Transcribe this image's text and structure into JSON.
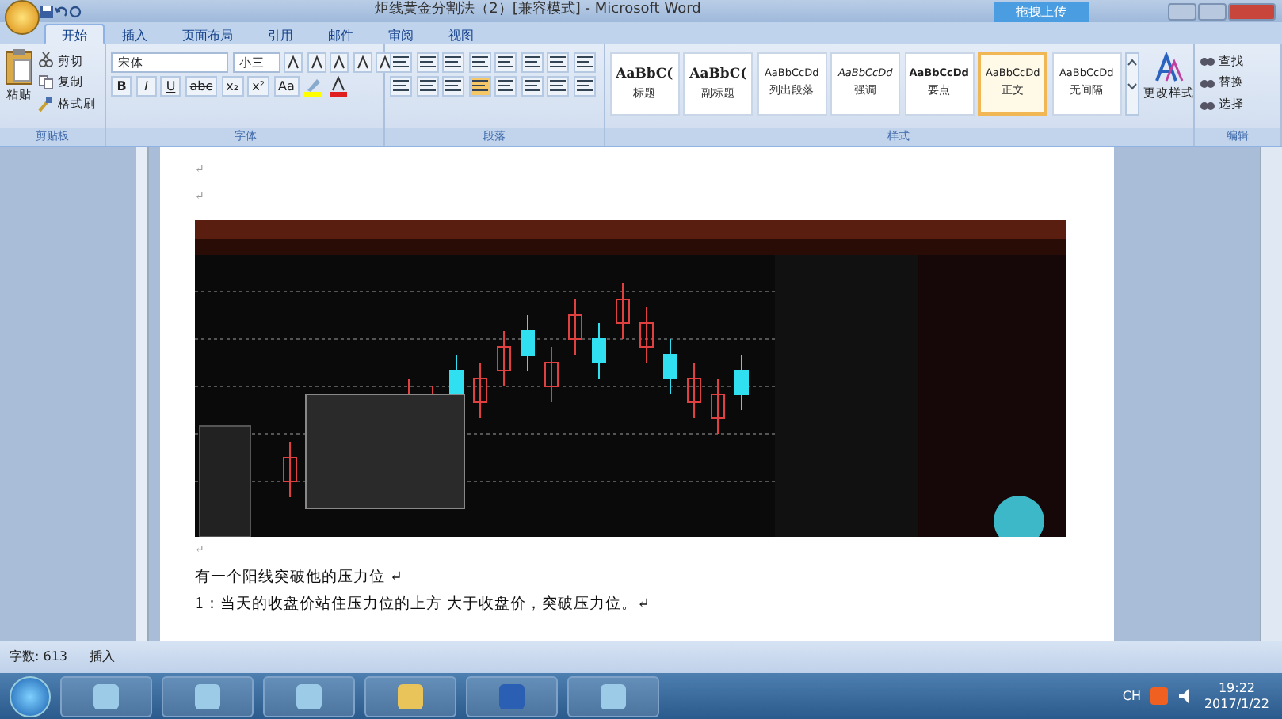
{
  "window": {
    "title": "炬线黄金分割法（2）[兼容模式] - Microsoft Word",
    "upload_button": "拖拽上传"
  },
  "tabs": [
    {
      "label": "开始",
      "selected": true
    },
    {
      "label": "插入",
      "selected": false
    },
    {
      "label": "页面布局",
      "selected": false
    },
    {
      "label": "引用",
      "selected": false
    },
    {
      "label": "邮件",
      "selected": false
    },
    {
      "label": "审阅",
      "selected": false
    },
    {
      "label": "视图",
      "selected": false
    }
  ],
  "clipboard": {
    "paste": "粘贴",
    "items": [
      "剪切",
      "复制",
      "格式刷"
    ],
    "label": "剪贴板"
  },
  "font": {
    "font_name": "宋体",
    "font_size": "小三",
    "format_buttons": [
      "B",
      "I",
      "U",
      "abc",
      "x₂",
      "x²",
      "Aa"
    ],
    "label": "字体"
  },
  "paragraph": {
    "label": "段落"
  },
  "styles": {
    "items": [
      {
        "preview": "AaBbC(",
        "name": "标题",
        "kind": "heading",
        "selected": false
      },
      {
        "preview": "AaBbC(",
        "name": "副标题",
        "kind": "heading",
        "selected": false
      },
      {
        "preview": "AaBbCcDd",
        "name": "列出段落",
        "kind": "plain",
        "selected": false
      },
      {
        "preview": "AaBbCcDd",
        "name": "强调",
        "kind": "italic",
        "selected": false
      },
      {
        "preview": "AaBbCcDd",
        "name": "要点",
        "kind": "bold",
        "selected": false
      },
      {
        "preview": "AaBbCcDd",
        "name": "正文",
        "kind": "plain",
        "selected": true
      },
      {
        "preview": "AaBbCcDd",
        "name": "无间隔",
        "kind": "plain",
        "selected": false
      }
    ],
    "change_styles": "更改样式",
    "label": "样式"
  },
  "editing": {
    "items": [
      "查找",
      "替换",
      "选择"
    ],
    "label": "编辑"
  },
  "document": {
    "paragraphs": [
      {
        "kind": "empty",
        "text": "↵"
      },
      {
        "kind": "empty",
        "text": "↵"
      },
      {
        "kind": "picture"
      },
      {
        "kind": "empty",
        "text": "↵"
      },
      {
        "kind": "text",
        "text": "有一个阳线突破他的压力位 ↵"
      },
      {
        "kind": "text",
        "text": "1：当天的收盘价站住压力位的上方 大于收盘价，突破压力位。↵"
      }
    ]
  },
  "status_bar": {
    "word_count": "字数: 613",
    "mode": "插入"
  },
  "taskbar": {
    "language": "CH",
    "time": "19:22",
    "date": "2017/1/22"
  }
}
